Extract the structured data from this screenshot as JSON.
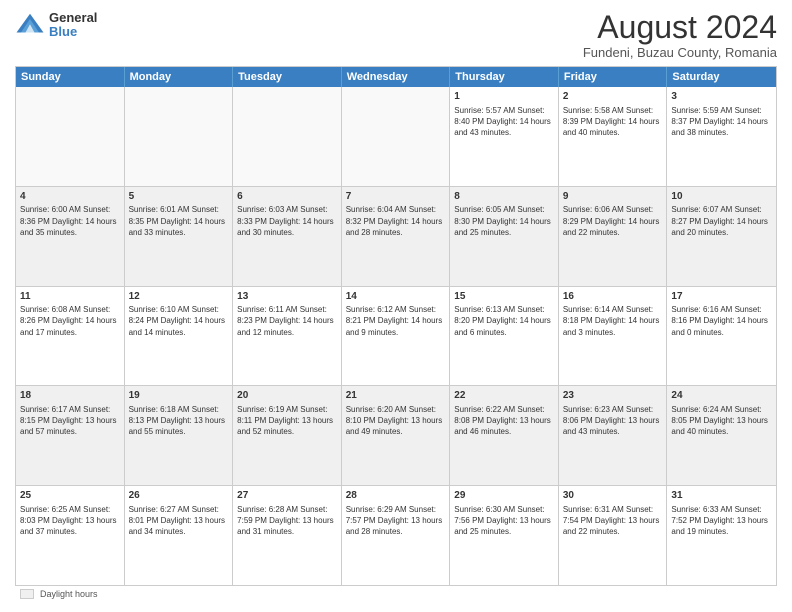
{
  "logo": {
    "general": "General",
    "blue": "Blue"
  },
  "title": "August 2024",
  "subtitle": "Fundeni, Buzau County, Romania",
  "days": [
    "Sunday",
    "Monday",
    "Tuesday",
    "Wednesday",
    "Thursday",
    "Friday",
    "Saturday"
  ],
  "footer": {
    "swatch_label": "Daylight hours"
  },
  "weeks": [
    [
      {
        "day": "",
        "info": ""
      },
      {
        "day": "",
        "info": ""
      },
      {
        "day": "",
        "info": ""
      },
      {
        "day": "",
        "info": ""
      },
      {
        "day": "1",
        "info": "Sunrise: 5:57 AM\nSunset: 8:40 PM\nDaylight: 14 hours\nand 43 minutes."
      },
      {
        "day": "2",
        "info": "Sunrise: 5:58 AM\nSunset: 8:39 PM\nDaylight: 14 hours\nand 40 minutes."
      },
      {
        "day": "3",
        "info": "Sunrise: 5:59 AM\nSunset: 8:37 PM\nDaylight: 14 hours\nand 38 minutes."
      }
    ],
    [
      {
        "day": "4",
        "info": "Sunrise: 6:00 AM\nSunset: 8:36 PM\nDaylight: 14 hours\nand 35 minutes."
      },
      {
        "day": "5",
        "info": "Sunrise: 6:01 AM\nSunset: 8:35 PM\nDaylight: 14 hours\nand 33 minutes."
      },
      {
        "day": "6",
        "info": "Sunrise: 6:03 AM\nSunset: 8:33 PM\nDaylight: 14 hours\nand 30 minutes."
      },
      {
        "day": "7",
        "info": "Sunrise: 6:04 AM\nSunset: 8:32 PM\nDaylight: 14 hours\nand 28 minutes."
      },
      {
        "day": "8",
        "info": "Sunrise: 6:05 AM\nSunset: 8:30 PM\nDaylight: 14 hours\nand 25 minutes."
      },
      {
        "day": "9",
        "info": "Sunrise: 6:06 AM\nSunset: 8:29 PM\nDaylight: 14 hours\nand 22 minutes."
      },
      {
        "day": "10",
        "info": "Sunrise: 6:07 AM\nSunset: 8:27 PM\nDaylight: 14 hours\nand 20 minutes."
      }
    ],
    [
      {
        "day": "11",
        "info": "Sunrise: 6:08 AM\nSunset: 8:26 PM\nDaylight: 14 hours\nand 17 minutes."
      },
      {
        "day": "12",
        "info": "Sunrise: 6:10 AM\nSunset: 8:24 PM\nDaylight: 14 hours\nand 14 minutes."
      },
      {
        "day": "13",
        "info": "Sunrise: 6:11 AM\nSunset: 8:23 PM\nDaylight: 14 hours\nand 12 minutes."
      },
      {
        "day": "14",
        "info": "Sunrise: 6:12 AM\nSunset: 8:21 PM\nDaylight: 14 hours\nand 9 minutes."
      },
      {
        "day": "15",
        "info": "Sunrise: 6:13 AM\nSunset: 8:20 PM\nDaylight: 14 hours\nand 6 minutes."
      },
      {
        "day": "16",
        "info": "Sunrise: 6:14 AM\nSunset: 8:18 PM\nDaylight: 14 hours\nand 3 minutes."
      },
      {
        "day": "17",
        "info": "Sunrise: 6:16 AM\nSunset: 8:16 PM\nDaylight: 14 hours\nand 0 minutes."
      }
    ],
    [
      {
        "day": "18",
        "info": "Sunrise: 6:17 AM\nSunset: 8:15 PM\nDaylight: 13 hours\nand 57 minutes."
      },
      {
        "day": "19",
        "info": "Sunrise: 6:18 AM\nSunset: 8:13 PM\nDaylight: 13 hours\nand 55 minutes."
      },
      {
        "day": "20",
        "info": "Sunrise: 6:19 AM\nSunset: 8:11 PM\nDaylight: 13 hours\nand 52 minutes."
      },
      {
        "day": "21",
        "info": "Sunrise: 6:20 AM\nSunset: 8:10 PM\nDaylight: 13 hours\nand 49 minutes."
      },
      {
        "day": "22",
        "info": "Sunrise: 6:22 AM\nSunset: 8:08 PM\nDaylight: 13 hours\nand 46 minutes."
      },
      {
        "day": "23",
        "info": "Sunrise: 6:23 AM\nSunset: 8:06 PM\nDaylight: 13 hours\nand 43 minutes."
      },
      {
        "day": "24",
        "info": "Sunrise: 6:24 AM\nSunset: 8:05 PM\nDaylight: 13 hours\nand 40 minutes."
      }
    ],
    [
      {
        "day": "25",
        "info": "Sunrise: 6:25 AM\nSunset: 8:03 PM\nDaylight: 13 hours\nand 37 minutes."
      },
      {
        "day": "26",
        "info": "Sunrise: 6:27 AM\nSunset: 8:01 PM\nDaylight: 13 hours\nand 34 minutes."
      },
      {
        "day": "27",
        "info": "Sunrise: 6:28 AM\nSunset: 7:59 PM\nDaylight: 13 hours\nand 31 minutes."
      },
      {
        "day": "28",
        "info": "Sunrise: 6:29 AM\nSunset: 7:57 PM\nDaylight: 13 hours\nand 28 minutes."
      },
      {
        "day": "29",
        "info": "Sunrise: 6:30 AM\nSunset: 7:56 PM\nDaylight: 13 hours\nand 25 minutes."
      },
      {
        "day": "30",
        "info": "Sunrise: 6:31 AM\nSunset: 7:54 PM\nDaylight: 13 hours\nand 22 minutes."
      },
      {
        "day": "31",
        "info": "Sunrise: 6:33 AM\nSunset: 7:52 PM\nDaylight: 13 hours\nand 19 minutes."
      }
    ]
  ]
}
